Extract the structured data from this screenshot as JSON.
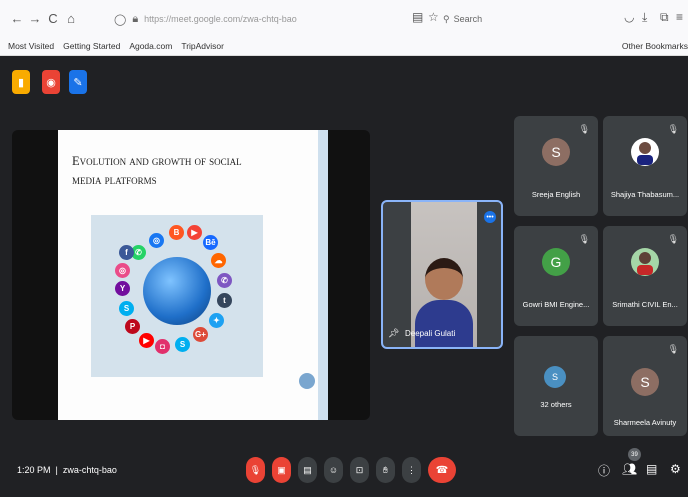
{
  "browser": {
    "url": "https://meet.google.com/zwa-chtq-bao",
    "search_placeholder": "Search",
    "bookmarks": [
      "Most Visited",
      "Getting Started",
      "Agoda.com",
      "TripAdvisor"
    ],
    "other_bookmarks": "Other Bookmarks"
  },
  "slide": {
    "title_line1": "Evolution and growth of social",
    "title_line2": "media platforms"
  },
  "speaker": {
    "name": "Deepali Gulati"
  },
  "participants": [
    {
      "name": "Sreeja English",
      "initial": "S",
      "color": "#8d6e63"
    },
    {
      "name": "Shajiya Thabasum...",
      "initial": "",
      "color": "#ffffff"
    },
    {
      "name": "Gowri BMI Engine...",
      "initial": "G",
      "color": "#43a047"
    },
    {
      "name": "Srimathi CIVIL En...",
      "initial": "",
      "color": "#a5d6a7"
    },
    {
      "name": "32 others",
      "initial": "",
      "color": "#4a90c2"
    },
    {
      "name": "Sharmeela Avinuty",
      "initial": "S",
      "color": "#8d6e63"
    }
  ],
  "meeting": {
    "time": "1:20 PM",
    "code": "zwa-chtq-bao",
    "people_count": "39"
  }
}
